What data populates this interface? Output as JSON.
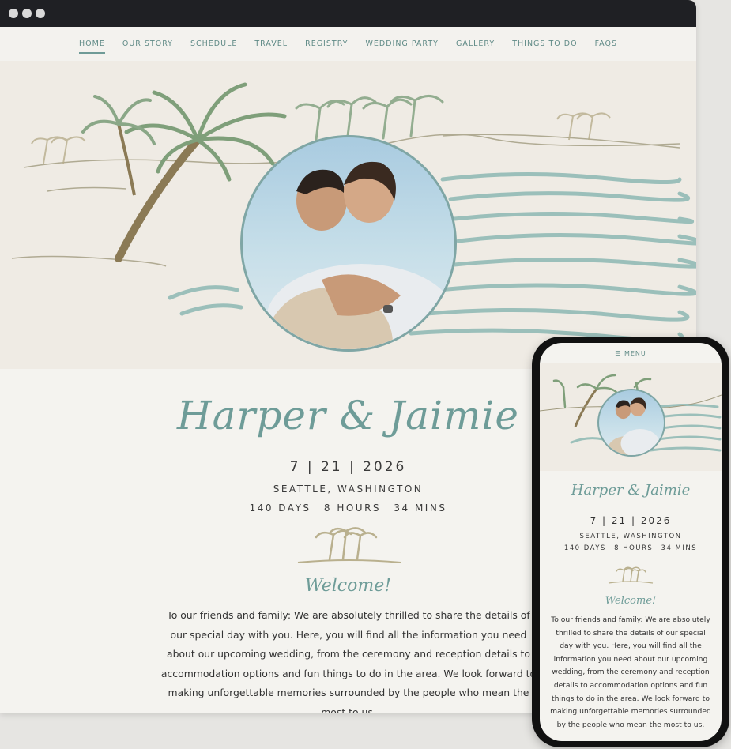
{
  "nav": {
    "items": [
      {
        "label": "HOME"
      },
      {
        "label": "OUR STORY"
      },
      {
        "label": "SCHEDULE"
      },
      {
        "label": "TRAVEL"
      },
      {
        "label": "REGISTRY"
      },
      {
        "label": "WEDDING PARTY"
      },
      {
        "label": "GALLERY"
      },
      {
        "label": "THINGS TO DO"
      },
      {
        "label": "FAQS"
      }
    ],
    "active": "HOME"
  },
  "couple": {
    "names": "Harper & Jaimie"
  },
  "event": {
    "date": "7 | 21 | 2026",
    "location": "SEATTLE, WASHINGTON",
    "countdown": {
      "days": "140 DAYS",
      "hours": "8 HOURS",
      "mins": "34 MINS"
    }
  },
  "welcome": {
    "heading": "Welcome!",
    "body": "To our friends and family: We are absolutely thrilled to share the details of our special day with you. Here, you will find all the information you need about our upcoming wedding, from the ceremony and reception details to accommodation options and fun things to do in the area. We look forward to making unforgettable memories surrounded by the people who mean the most to us."
  },
  "mobile": {
    "menu_label": "MENU"
  },
  "colors": {
    "accent": "#6e9c98",
    "titlebar": "#1f2024",
    "background": "#f4f3ef"
  }
}
